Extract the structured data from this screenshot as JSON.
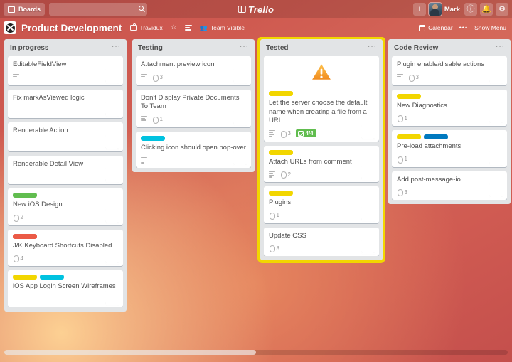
{
  "topbar": {
    "boards_label": "Boards",
    "search_placeholder": "",
    "search_value": "",
    "brand": "Trello",
    "add_label": "+",
    "user_name": "Mark",
    "info_label": "!",
    "notifications_label": "⚑",
    "settings_label": "⚙"
  },
  "board_header": {
    "title": "Product Development",
    "org": "Travidux",
    "star": "☆",
    "visibility": "Team Visible",
    "calendar": "Calendar",
    "more_dots": "•••",
    "show_menu": "Show Menu"
  },
  "colors": {
    "label_yellow": "#f2d600",
    "label_green": "#61bd4f",
    "label_red": "#eb5a46",
    "label_blue": "#0079bf",
    "label_sky": "#00c2e0",
    "highlight": "#f2d600",
    "done_badge": "#61bd4f"
  },
  "lists": [
    {
      "title": "In progress",
      "dots": "···",
      "highlight": false,
      "cards": [
        {
          "title": "EditableFieldView",
          "labels": [],
          "desc": true,
          "attachments": null,
          "checklist": null,
          "cover": false,
          "skin": "#d8b08c",
          "cloth": "#3a3027"
        },
        {
          "title": "Fix markAsViewed logic",
          "labels": [],
          "desc": false,
          "attachments": null,
          "checklist": null,
          "cover": false,
          "skin": "#c98f66",
          "cloth": "#2f7f86"
        },
        {
          "title": "Renderable Action",
          "labels": [],
          "desc": false,
          "attachments": null,
          "checklist": null,
          "cover": false,
          "skin": "#e0b088",
          "cloth": "#c99a5a"
        },
        {
          "title": "Renderable Detail View",
          "labels": [],
          "desc": false,
          "attachments": null,
          "checklist": null,
          "cover": false,
          "skin": "#cfa57e",
          "cloth": "#4a5a66"
        },
        {
          "title": "New iOS Design",
          "labels": [
            "#61bd4f"
          ],
          "desc": false,
          "attachments": "2",
          "checklist": null,
          "cover": false,
          "skin": "#c6a184",
          "cloth": "#2b2722"
        },
        {
          "title": "J/K Keyboard Shortcuts Disabled",
          "labels": [
            "#eb5a46"
          ],
          "desc": false,
          "attachments": "4",
          "checklist": null,
          "cover": false,
          "skin": "#d6b49a",
          "cloth": "#3d4147"
        },
        {
          "title": "iOS App Login Screen Wireframes",
          "labels": [
            "#f2d600",
            "#00c2e0"
          ],
          "desc": false,
          "attachments": null,
          "checklist": null,
          "cover": false,
          "skin": "#c08a5e",
          "cloth": "#6d5a3a"
        }
      ]
    },
    {
      "title": "Testing",
      "dots": "···",
      "highlight": false,
      "cards": [
        {
          "title": "Attachment preview icon",
          "labels": [],
          "desc": true,
          "attachments": "3",
          "checklist": null,
          "cover": false,
          "skin": "#d2a272",
          "cloth": "#b4892f"
        },
        {
          "title": "Don't Display Private Documents To Team",
          "labels": [],
          "desc": true,
          "attachments": "1",
          "checklist": null,
          "cover": false,
          "skin": "#cfa07a",
          "cloth": "#4a3b33"
        },
        {
          "title": "Clicking icon should open pop-over",
          "labels": [
            "#00c2e0"
          ],
          "desc": true,
          "attachments": null,
          "checklist": null,
          "cover": false,
          "skin": "#d2a272",
          "cloth": "#b4892f"
        }
      ]
    },
    {
      "title": "Tested",
      "dots": "···",
      "highlight": true,
      "cards": [
        {
          "title": "Let the server choose the default name when creating a file from a URL",
          "labels": [
            "#f2d600"
          ],
          "desc": true,
          "attachments": "3",
          "checklist": "4/4",
          "cover": true,
          "skin": "#b9835a",
          "cloth": "#3a6f4a"
        },
        {
          "title": "Attach URLs from comment",
          "labels": [
            "#f2d600"
          ],
          "desc": true,
          "attachments": "2",
          "checklist": null,
          "cover": false,
          "skin": "#d2a272",
          "cloth": "#b4892f"
        },
        {
          "title": "Plugins",
          "labels": [
            "#f2d600"
          ],
          "desc": false,
          "attachments": "1",
          "checklist": null,
          "cover": false,
          "skin": "#d6a98c",
          "cloth": "#5a3a32"
        },
        {
          "title": "Update CSS",
          "labels": [],
          "desc": false,
          "attachments": "8",
          "checklist": null,
          "cover": false,
          "skin": "#c08a5e",
          "cloth": "#4e7a4a"
        }
      ]
    },
    {
      "title": "Code Review",
      "dots": "···",
      "highlight": false,
      "cards": [
        {
          "title": "Plugin enable/disable actions",
          "labels": [],
          "desc": true,
          "attachments": "3",
          "checklist": null,
          "cover": false,
          "skin": "#c08a5e",
          "cloth": "#2f7f86"
        },
        {
          "title": "New Diagnostics",
          "labels": [
            "#f2d600"
          ],
          "desc": false,
          "attachments": "1",
          "checklist": null,
          "cover": false,
          "skin": "#c08a5e",
          "cloth": "#2f7f86"
        },
        {
          "title": "Pre-load attachments",
          "labels": [
            "#f2d600",
            "#0079bf"
          ],
          "desc": false,
          "attachments": "1",
          "checklist": null,
          "cover": false,
          "skin": "#d8a87e",
          "cloth": "#e8d9c8"
        },
        {
          "title": "Add post-message-io",
          "labels": [],
          "desc": false,
          "attachments": "3",
          "checklist": null,
          "cover": false,
          "skin": "#b07a52",
          "cloth": "#d9683f"
        }
      ]
    }
  ],
  "scrollbar": {
    "thumb_percent": 50
  }
}
